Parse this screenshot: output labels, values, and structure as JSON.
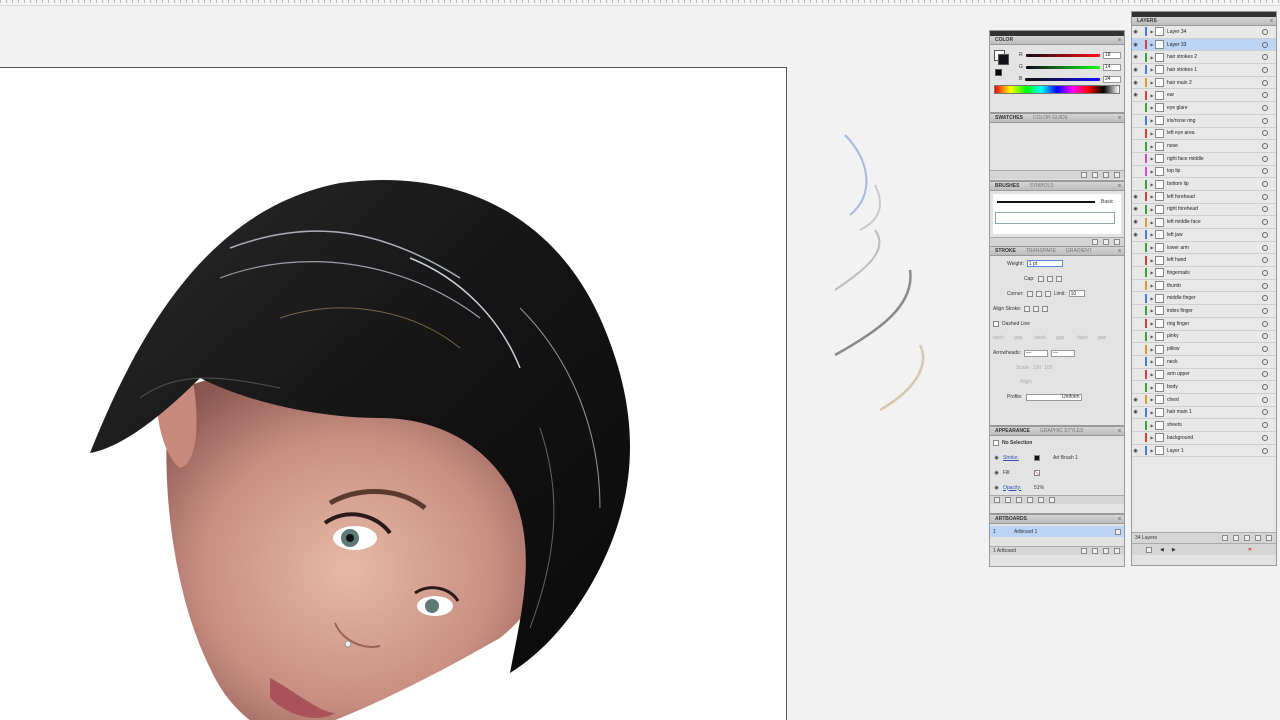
{
  "color_panel": {
    "title": "COLOR",
    "r_label": "R",
    "g_label": "G",
    "b_label": "B",
    "r_value": "18",
    "g_value": "14",
    "b_value": "24"
  },
  "swatches_panel": {
    "tab_swatches": "SWATCHES",
    "tab_color_guide": "COLOR GUIDE"
  },
  "brushes_panel": {
    "tab_brushes": "BRUSHES",
    "tab_symbols": "SYMBOLS",
    "brush_basic": "Basic"
  },
  "stroke_panel": {
    "tab_stroke": "STROKE",
    "tab_transparency": "TRANSPARE",
    "tab_gradient": "GRADIENT",
    "weight_label": "Weight:",
    "weight_value": "1 pt",
    "cap_label": "Cap:",
    "corner_label": "Corner:",
    "limit_label": "Limit:",
    "limit_value": "10",
    "align_label": "Align Stroke:",
    "dashed_label": "Dashed Line",
    "dash_labels": [
      "dash",
      "gap",
      "dash",
      "gap",
      "dash",
      "gap"
    ],
    "arrowheads_label": "Arrowheads:",
    "scale_label": "Scale:",
    "scale_1": "100",
    "scale_2": "100",
    "align_label2": "Align:",
    "profile_label": "Profile:",
    "profile_value": "Uniform"
  },
  "appearance_panel": {
    "tab_appearance": "APPEARANCE",
    "tab_graphic_styles": "GRAPHIC STYLES",
    "no_selection": "No Selection",
    "stroke_label": "Stroke:",
    "stroke_brush": "Art Brush 1",
    "fill_label": "Fill:",
    "opacity_label": "Opacity:",
    "opacity_value": "51%"
  },
  "artboards_panel": {
    "title": "ARTBOARDS",
    "artboard_num": "1",
    "artboard_name": "Artboard 1",
    "footer": "1 Artboard"
  },
  "layers_panel": {
    "title": "LAYERS",
    "footer": "34 Layers",
    "layers": [
      {
        "name": "Layer 34",
        "color": "#4a7bd0",
        "eye": true,
        "sel": false
      },
      {
        "name": "Layer 33",
        "color": "#d04040",
        "eye": true,
        "sel": true
      },
      {
        "name": "hair strokes 2",
        "color": "#3aa03a",
        "eye": true,
        "sel": false
      },
      {
        "name": "hair strokes 1",
        "color": "#4a7bd0",
        "eye": true,
        "sel": false
      },
      {
        "name": "hair main 2",
        "color": "#d0a030",
        "eye": true,
        "sel": false
      },
      {
        "name": "ear",
        "color": "#d04040",
        "eye": true,
        "sel": false
      },
      {
        "name": "eye glare",
        "color": "#3aa03a",
        "eye": false,
        "sel": false
      },
      {
        "name": "iris/nose ring",
        "color": "#4a7bd0",
        "eye": false,
        "sel": false
      },
      {
        "name": "left eye area",
        "color": "#d04040",
        "eye": false,
        "sel": false
      },
      {
        "name": "nose",
        "color": "#3aa03a",
        "eye": false,
        "sel": false
      },
      {
        "name": "right face middle",
        "color": "#c050c0",
        "eye": false,
        "sel": false
      },
      {
        "name": "top lip",
        "color": "#d050d0",
        "eye": false,
        "sel": false
      },
      {
        "name": "bottom lip",
        "color": "#3aa03a",
        "eye": false,
        "sel": false
      },
      {
        "name": "left forehead",
        "color": "#d04040",
        "eye": true,
        "sel": false
      },
      {
        "name": "right forehead",
        "color": "#3aa03a",
        "eye": true,
        "sel": false
      },
      {
        "name": "left middle face",
        "color": "#d0a030",
        "eye": true,
        "sel": false
      },
      {
        "name": "left jaw",
        "color": "#4a7bd0",
        "eye": true,
        "sel": false
      },
      {
        "name": "lower arm",
        "color": "#3aa03a",
        "eye": false,
        "sel": false
      },
      {
        "name": "left hand",
        "color": "#d04040",
        "eye": false,
        "sel": false
      },
      {
        "name": "fingernails",
        "color": "#3aa03a",
        "eye": false,
        "sel": false
      },
      {
        "name": "thumb",
        "color": "#d0a030",
        "eye": false,
        "sel": false
      },
      {
        "name": "middle finger",
        "color": "#4a7bd0",
        "eye": false,
        "sel": false
      },
      {
        "name": "index finger",
        "color": "#3aa03a",
        "eye": false,
        "sel": false
      },
      {
        "name": "ring finger",
        "color": "#d04040",
        "eye": false,
        "sel": false
      },
      {
        "name": "pinky",
        "color": "#3aa03a",
        "eye": false,
        "sel": false
      },
      {
        "name": "pillow",
        "color": "#d0a030",
        "eye": false,
        "sel": false
      },
      {
        "name": "neck",
        "color": "#4a7bd0",
        "eye": false,
        "sel": false
      },
      {
        "name": "arm upper",
        "color": "#d04040",
        "eye": false,
        "sel": false
      },
      {
        "name": "body",
        "color": "#3aa03a",
        "eye": false,
        "sel": false
      },
      {
        "name": "chest",
        "color": "#d0a030",
        "eye": true,
        "sel": false
      },
      {
        "name": "hair main 1",
        "color": "#4a7bd0",
        "eye": true,
        "sel": false
      },
      {
        "name": "sheets",
        "color": "#3aa03a",
        "eye": false,
        "sel": false
      },
      {
        "name": "background",
        "color": "#d04040",
        "eye": false,
        "sel": false
      },
      {
        "name": "Layer 1",
        "color": "#4a7bd0",
        "eye": true,
        "sel": false
      }
    ]
  }
}
